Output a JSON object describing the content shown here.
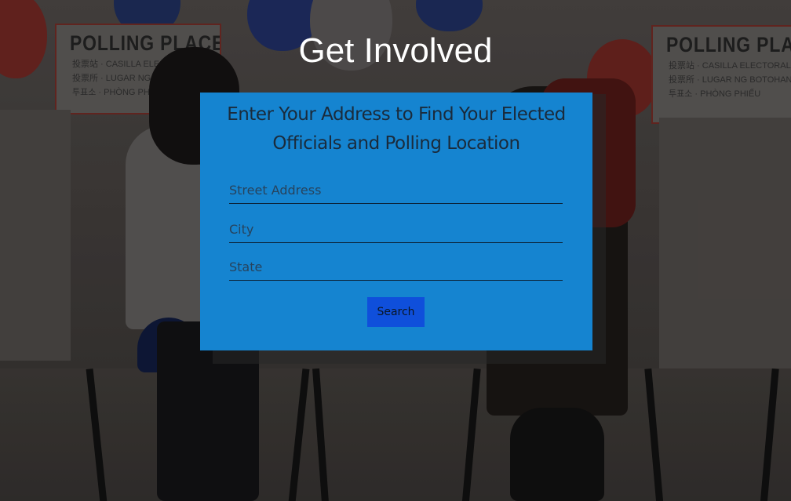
{
  "page": {
    "title": "Get Involved"
  },
  "background": {
    "sign_left": {
      "title": "POLLING PLACE",
      "lines": [
        "投票站 · CASILLA ELEC",
        "投票所 · LUGAR NG",
        "투표소 · PHÒNG PHI"
      ]
    },
    "sign_right": {
      "title": "POLLING PLACE",
      "lines": [
        "投票站 · CASILLA ELECTORAL",
        "投票所 · LUGAR NG BOTOHAN",
        "투표소 · PHÒNG PHIẾU"
      ]
    }
  },
  "form": {
    "heading": "Enter Your Address to Find Your Elected Officials and Polling Location",
    "street_placeholder": "Street Address",
    "city_placeholder": "City",
    "state_placeholder": "State",
    "street_value": "",
    "city_value": "",
    "state_value": "",
    "search_label": "Search"
  },
  "colors": {
    "card": "#1584d0",
    "button": "#0f4fdb",
    "title": "#ffffff"
  }
}
